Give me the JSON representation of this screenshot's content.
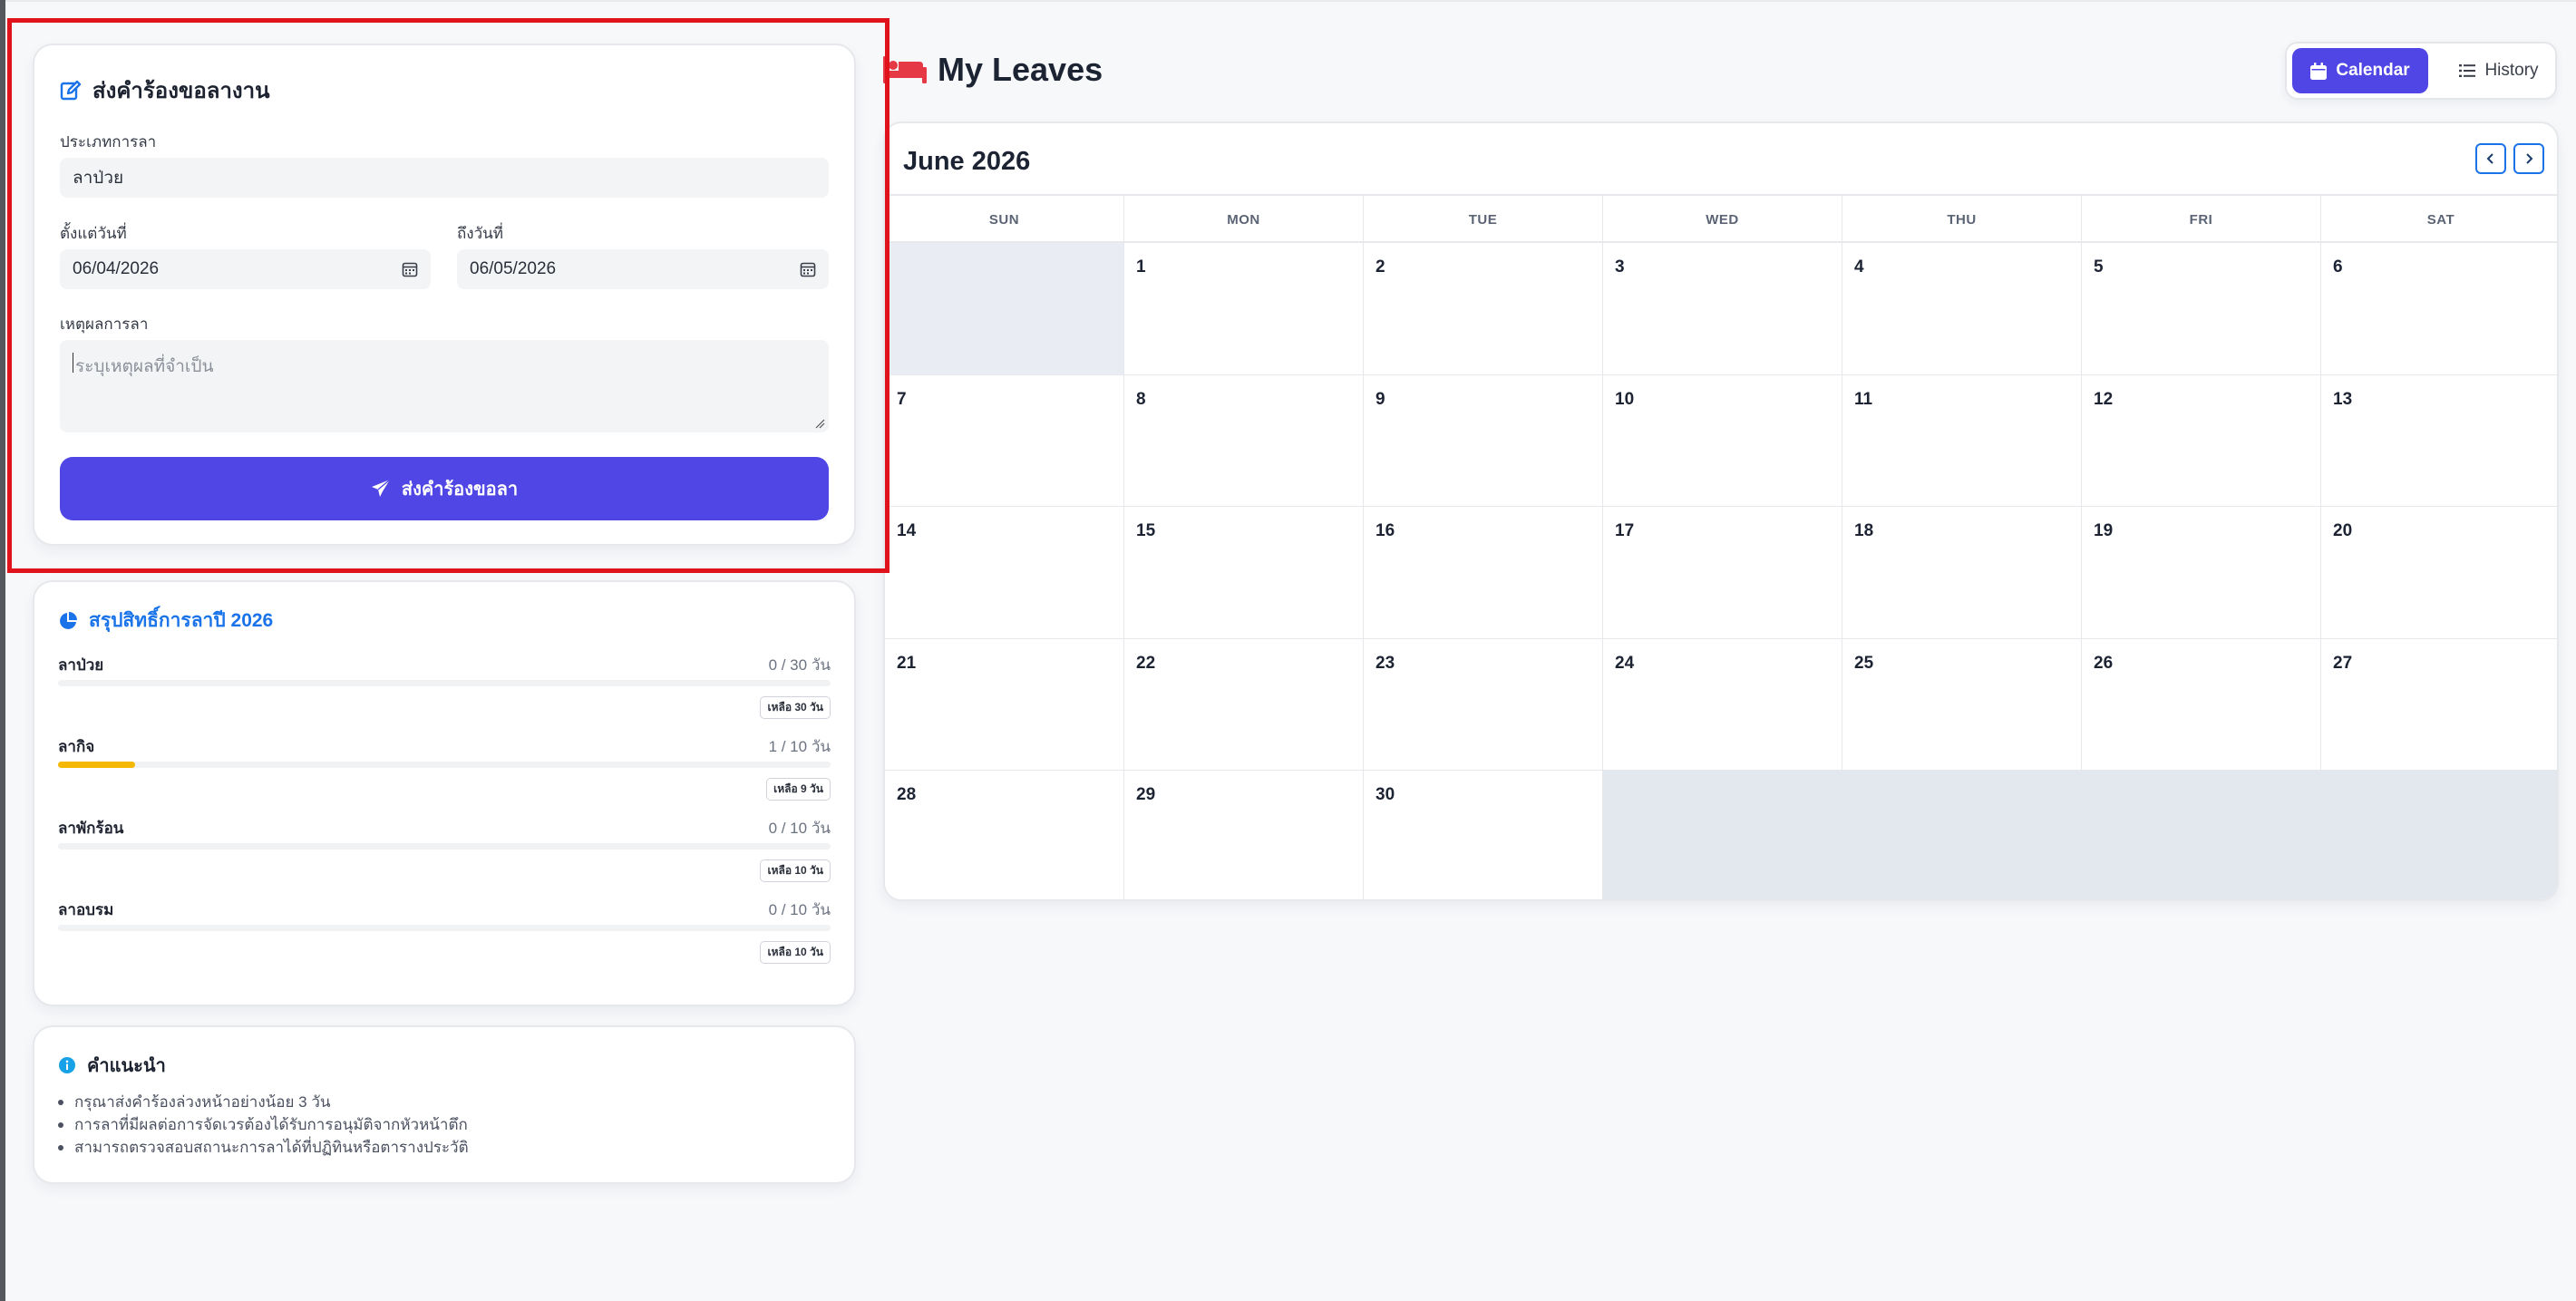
{
  "form": {
    "title": "ส่งคำร้องขอลางาน",
    "leave_type_label": "ประเภทการลา",
    "leave_type_value": "ลาป่วย",
    "start_label": "ตั้งแต่วันที่",
    "start_value": "06/04/2026",
    "end_label": "ถึงวันที่",
    "end_value": "06/05/2026",
    "reason_label": "เหตุผลการลา",
    "reason_placeholder": "ระบุเหตุผลที่จำเป็น",
    "submit_label": "ส่งคำร้องขอลา"
  },
  "summary": {
    "title": "สรุปสิทธิ์การลาปี 2026",
    "items": [
      {
        "name": "ลาป่วย",
        "count": "0 / 30 วัน",
        "remaining": "เหลือ 30 วัน",
        "used_fraction": 0
      },
      {
        "name": "ลากิจ",
        "count": "1 / 10 วัน",
        "remaining": "เหลือ 9 วัน",
        "used_fraction": 0.1
      },
      {
        "name": "ลาพักร้อน",
        "count": "0 / 10 วัน",
        "remaining": "เหลือ 10 วัน",
        "used_fraction": 0
      },
      {
        "name": "ลาอบรม",
        "count": "0 / 10 วัน",
        "remaining": "เหลือ 10 วัน",
        "used_fraction": 0
      }
    ]
  },
  "tips": {
    "title": "คำแนะนำ",
    "items": [
      "กรุณาส่งคำร้องล่วงหน้าอย่างน้อย 3 วัน",
      "การลาที่มีผลต่อการจัดเวรต้องได้รับการอนุมัติจากหัวหน้าตึก",
      "สามารถตรวจสอบสถานะการลาได้ที่ปฏิทินหรือตารางประวัติ"
    ]
  },
  "header": {
    "title": "My Leaves",
    "calendar_label": "Calendar",
    "history_label": "History"
  },
  "calendar": {
    "month_title": "June 2026",
    "weekdays": [
      "SUN",
      "MON",
      "TUE",
      "WED",
      "THU",
      "FRI",
      "SAT"
    ],
    "days": [
      "",
      "1",
      "2",
      "3",
      "4",
      "5",
      "6",
      "7",
      "8",
      "9",
      "10",
      "11",
      "12",
      "13",
      "14",
      "15",
      "16",
      "17",
      "18",
      "19",
      "20",
      "21",
      "22",
      "23",
      "24",
      "25",
      "26",
      "27",
      "28",
      "29",
      "30"
    ]
  },
  "colors": {
    "accent": "#4f46e5",
    "link_blue": "#1a73e8",
    "progress_yellow": "#f5b800",
    "highlight_red": "#e0121b",
    "bed_icon_red": "#e53945"
  }
}
